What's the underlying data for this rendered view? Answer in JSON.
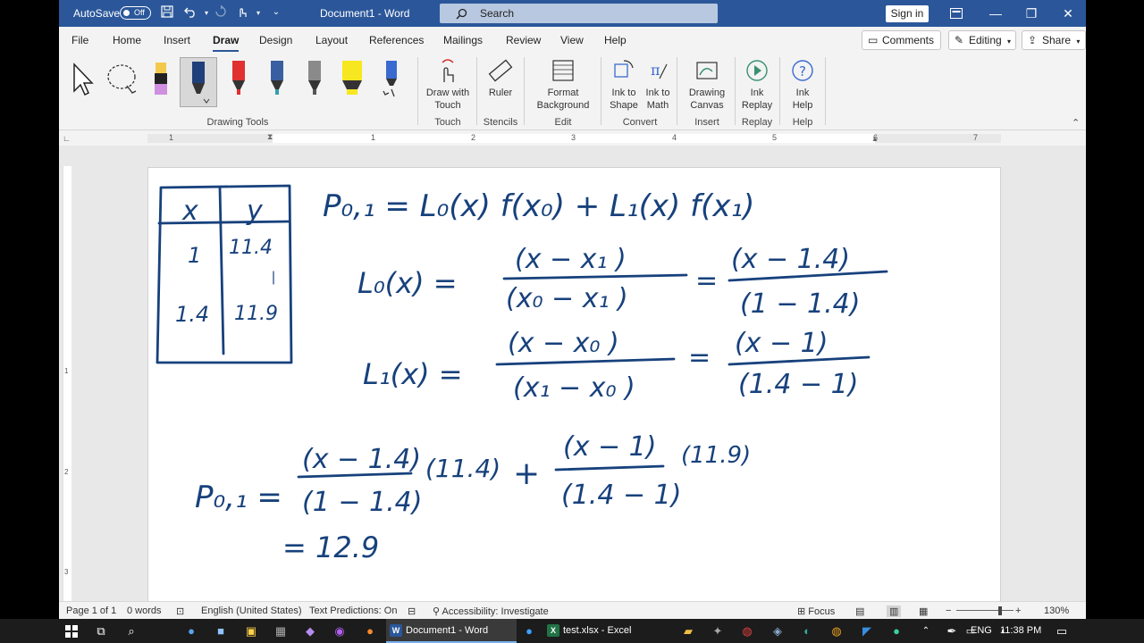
{
  "titlebar": {
    "autosave_label": "AutoSave",
    "autosave_state": "Off",
    "doc_title": "Document1  -  Word",
    "search_placeholder": "Search",
    "signin_label": "Sign in"
  },
  "menu": {
    "tabs": [
      "File",
      "Home",
      "Insert",
      "Draw",
      "Design",
      "Layout",
      "References",
      "Mailings",
      "Review",
      "View",
      "Help"
    ],
    "active_tab": "Draw",
    "comments_label": "Comments",
    "editing_label": "Editing",
    "share_label": "Share"
  },
  "ribbon": {
    "group_drawing_tools": "Drawing Tools",
    "draw_with_touch": "Draw with Touch",
    "group_touch": "Touch",
    "ruler": "Ruler",
    "group_stencils": "Stencils",
    "format_background": "Format Background",
    "group_edit": "Edit",
    "ink_to_shape": "Ink to Shape",
    "ink_to_math": "Ink to Math",
    "group_convert": "Convert",
    "drawing_canvas": "Drawing Canvas",
    "group_insert": "Insert",
    "ink_replay": "Ink Replay",
    "group_replay": "Replay",
    "ink_help": "Ink Help",
    "group_help": "Help"
  },
  "ruler": {
    "numbers": [
      "1",
      "1",
      "2",
      "3",
      "4",
      "5",
      "6",
      "7"
    ],
    "vertical_numbers": [
      "1",
      "2",
      "3"
    ]
  },
  "handwriting": {
    "table_header_x": "x",
    "table_header_y": "y",
    "table_rows": [
      [
        "1",
        "11.4"
      ],
      [
        "1.4",
        "11.9"
      ]
    ],
    "p01_formula": "P₀,₁ = L₀(x) f(x₀) + L₁(x) f(x₁)",
    "l0_left": "L₀(x) =",
    "l0_num": "(x − x₁ )",
    "l0_den": "(x₀ − x₁ )",
    "l0_num2": "(x − 1.4)",
    "l0_den2": "(1 − 1.4)",
    "l1_left": "L₁(x) =",
    "l1_num": "(x − x₀ )",
    "l1_den": "(x₁ − x₀ )",
    "l1_num2": "(x − 1)",
    "l1_den2": "(1.4 − 1)",
    "p_left": "P₀,₁ =",
    "term1_num": "(x − 1.4)",
    "term1_den": "(1 − 1.4)",
    "term1_val": "(11.4)",
    "term2_num": "(x − 1)",
    "term2_den": "(1.4 − 1)",
    "term2_val": "(11.9)",
    "result": "= 12.9"
  },
  "status": {
    "page": "Page 1 of 1",
    "words": "0 words",
    "language": "English (United States)",
    "predictions": "Text Predictions: On",
    "accessibility": "Accessibility: Investigate",
    "focus": "Focus",
    "zoom": "130%"
  },
  "taskbar": {
    "word_app": "Document1 - Word",
    "excel_app": "test.xlsx - Excel",
    "lang": "ENG",
    "time": "11:38 PM"
  },
  "colors": {
    "word_blue": "#2b579a",
    "ink_blue": "#17417c"
  }
}
